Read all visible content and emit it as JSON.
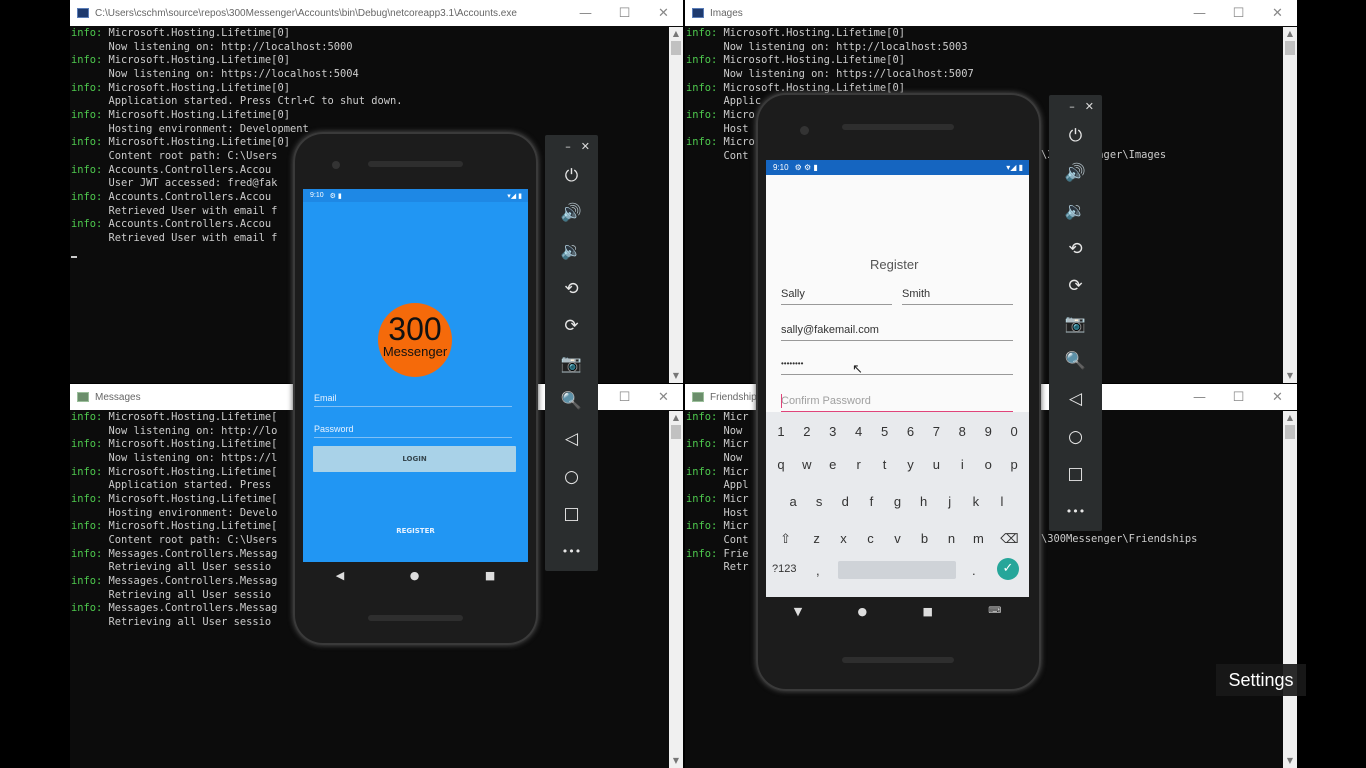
{
  "windows": {
    "accounts": {
      "title": "C:\\Users\\cschm\\source\\repos\\300Messenger\\Accounts\\bin\\Debug\\netcoreapp3.1\\Accounts.exe",
      "lines": [
        [
          "info:",
          " Microsoft.Hosting.Lifetime[0]"
        ],
        [
          "",
          "      Now listening on: http://localhost:5000"
        ],
        [
          "info:",
          " Microsoft.Hosting.Lifetime[0]"
        ],
        [
          "",
          "      Now listening on: https://localhost:5004"
        ],
        [
          "info:",
          " Microsoft.Hosting.Lifetime[0]"
        ],
        [
          "",
          "      Application started. Press Ctrl+C to shut down."
        ],
        [
          "info:",
          " Microsoft.Hosting.Lifetime[0]"
        ],
        [
          "",
          "      Hosting environment: Development"
        ],
        [
          "info:",
          " Microsoft.Hosting.Lifetime[0]"
        ],
        [
          "",
          "      Content root path: C:\\Users"
        ],
        [
          "info:",
          " Accounts.Controllers.Accou"
        ],
        [
          "",
          "      User JWT accessed: fred@fak"
        ],
        [
          "info:",
          " Accounts.Controllers.Accou"
        ],
        [
          "",
          "      Retrieved User with email f"
        ],
        [
          "info:",
          " Accounts.Controllers.Accou"
        ],
        [
          "",
          "      Retrieved User with email f"
        ]
      ]
    },
    "images": {
      "title": "Images",
      "lines": [
        [
          "info:",
          " Microsoft.Hosting.Lifetime[0]"
        ],
        [
          "",
          "      Now listening on: http://localhost:5003"
        ],
        [
          "info:",
          " Microsoft.Hosting.Lifetime[0]"
        ],
        [
          "",
          "      Now listening on: https://localhost:5007"
        ],
        [
          "info:",
          " Microsoft.Hosting.Lifetime[0]"
        ],
        [
          "",
          "      Applic"
        ],
        [
          "info:",
          " Micro"
        ],
        [
          "",
          "      Host"
        ],
        [
          "info:",
          " Micro"
        ],
        [
          "",
          "      Cont"
        ]
      ],
      "path_fragment": "\\300Messenger\\Images"
    },
    "messages": {
      "title": "Messages",
      "lines": [
        [
          "info:",
          " Microsoft.Hosting.Lifetime["
        ],
        [
          "",
          "      Now listening on: http://lo"
        ],
        [
          "info:",
          " Microsoft.Hosting.Lifetime["
        ],
        [
          "",
          "      Now listening on: https://l"
        ],
        [
          "info:",
          " Microsoft.Hosting.Lifetime["
        ],
        [
          "",
          "      Application started. Press"
        ],
        [
          "info:",
          " Microsoft.Hosting.Lifetime["
        ],
        [
          "",
          "      Hosting environment: Develo"
        ],
        [
          "info:",
          " Microsoft.Hosting.Lifetime["
        ],
        [
          "",
          "      Content root path: C:\\Users"
        ],
        [
          "info:",
          " Messages.Controllers.Messag"
        ],
        [
          "",
          "      Retrieving all User sessio"
        ],
        [
          "info:",
          " Messages.Controllers.Messag"
        ],
        [
          "",
          "      Retrieving all User sessio"
        ],
        [
          "info:",
          " Messages.Controllers.Messag"
        ],
        [
          "",
          "      Retrieving all User sessio"
        ]
      ]
    },
    "friendships": {
      "title": "Friendship",
      "lines": [
        [
          "info:",
          " Micr"
        ],
        [
          "",
          "      Now"
        ],
        [
          "info:",
          " Micr"
        ],
        [
          "",
          "      Now"
        ],
        [
          "info:",
          " Micr"
        ],
        [
          "",
          "      Appl"
        ],
        [
          "info:",
          " Micr"
        ],
        [
          "",
          "      Host"
        ],
        [
          "info:",
          " Micr"
        ],
        [
          "",
          "      Cont"
        ],
        [
          "info:",
          " Frie"
        ],
        [
          "",
          "      Retr"
        ]
      ],
      "path_fragment": "\\300Messenger\\Friendships"
    }
  },
  "window_controls": {
    "minimize": "—",
    "maximize": "☐",
    "close": "✕"
  },
  "emulator_toolbar": {
    "close": "✕",
    "minimize": "–",
    "buttons": [
      "power-icon",
      "volume-up-icon",
      "volume-down-icon",
      "rotate-left-icon",
      "rotate-right-icon",
      "camera-icon",
      "zoom-icon",
      "back-icon",
      "home-icon",
      "overview-icon",
      "more-icon"
    ],
    "glyphs": [
      "⏻",
      "🔊",
      "🔉",
      "⟲",
      "⟳",
      "📷",
      "🔍",
      "◁",
      "○",
      "□",
      "•••"
    ]
  },
  "phone_login": {
    "time": "9:10",
    "logo_number": "300",
    "logo_text": "Messenger",
    "email_placeholder": "Email",
    "password_placeholder": "Password",
    "login_label": "LOGIN",
    "register_label": "REGISTER",
    "colors": {
      "background": "#2196f3",
      "logo": "#f56a0a",
      "login_button": "#a9d2e8"
    }
  },
  "phone_register": {
    "time": "9:10",
    "title": "Register",
    "first_name": "Sally",
    "last_name": "Smith",
    "email": "sally@fakemail.com",
    "password": "••••••••",
    "confirm_placeholder": "Confirm Password",
    "keyboard": {
      "numbers": [
        "1",
        "2",
        "3",
        "4",
        "5",
        "6",
        "7",
        "8",
        "9",
        "0"
      ],
      "row1": [
        "q",
        "w",
        "e",
        "r",
        "t",
        "y",
        "u",
        "i",
        "o",
        "p"
      ],
      "row2": [
        "a",
        "s",
        "d",
        "f",
        "g",
        "h",
        "j",
        "k",
        "l"
      ],
      "row3": [
        "z",
        "x",
        "c",
        "v",
        "b",
        "n",
        "m"
      ],
      "shift": "⇧",
      "backspace": "⌫",
      "symbols": "?123",
      "comma": ",",
      "period": ".",
      "enter": "✓"
    },
    "colors": {
      "statusbar": "#1565c0",
      "accent": "#e0447a",
      "enter": "#26a69a"
    }
  },
  "settings_label": "Settings"
}
